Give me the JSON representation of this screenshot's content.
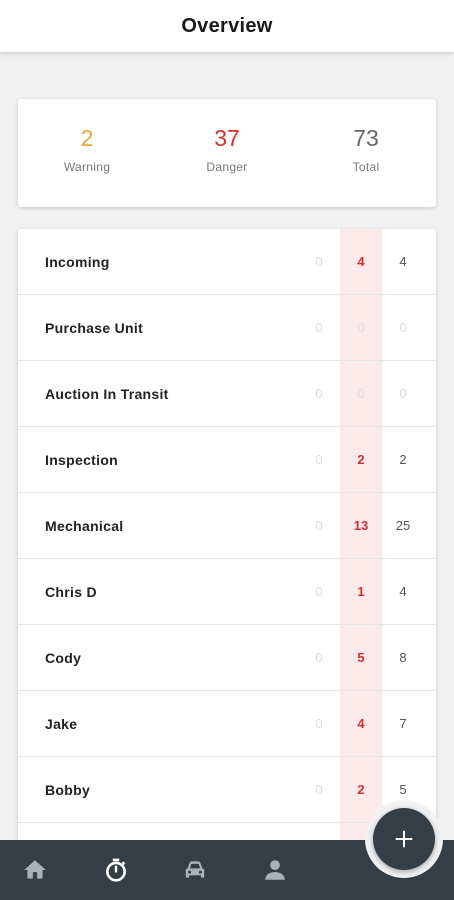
{
  "header": {
    "title": "Overview"
  },
  "summary": {
    "warning": {
      "value": "2",
      "label": "Warning"
    },
    "danger": {
      "value": "37",
      "label": "Danger"
    },
    "total": {
      "value": "73",
      "label": "Total"
    }
  },
  "rows": [
    {
      "name": "Incoming",
      "warning": "0",
      "danger": "4",
      "total": "4"
    },
    {
      "name": "Purchase Unit",
      "warning": "0",
      "danger": "0",
      "total": "0"
    },
    {
      "name": "Auction In Transit",
      "warning": "0",
      "danger": "0",
      "total": "0"
    },
    {
      "name": "Inspection",
      "warning": "0",
      "danger": "2",
      "total": "2"
    },
    {
      "name": "Mechanical",
      "warning": "0",
      "danger": "13",
      "total": "25"
    },
    {
      "name": "Chris D",
      "warning": "0",
      "danger": "1",
      "total": "4"
    },
    {
      "name": "Cody",
      "warning": "0",
      "danger": "5",
      "total": "8"
    },
    {
      "name": "Jake",
      "warning": "0",
      "danger": "4",
      "total": "7"
    },
    {
      "name": "Bobby",
      "warning": "0",
      "danger": "2",
      "total": "5"
    },
    {
      "name": "",
      "warning": "",
      "danger": "",
      "total": ""
    }
  ],
  "nav": {
    "items": [
      {
        "icon": "home-icon"
      },
      {
        "icon": "stopwatch-icon",
        "active": true
      },
      {
        "icon": "car-icon"
      },
      {
        "icon": "person-icon"
      }
    ]
  },
  "fab": {
    "icon": "plus-icon"
  },
  "colors": {
    "warning": "#f0a43a",
    "danger": "#d32f2f",
    "danger_bg": "#fce9ea",
    "nav_bg": "#343e46",
    "nav_icon": "#aab1b7",
    "nav_icon_active": "#ffffff"
  }
}
